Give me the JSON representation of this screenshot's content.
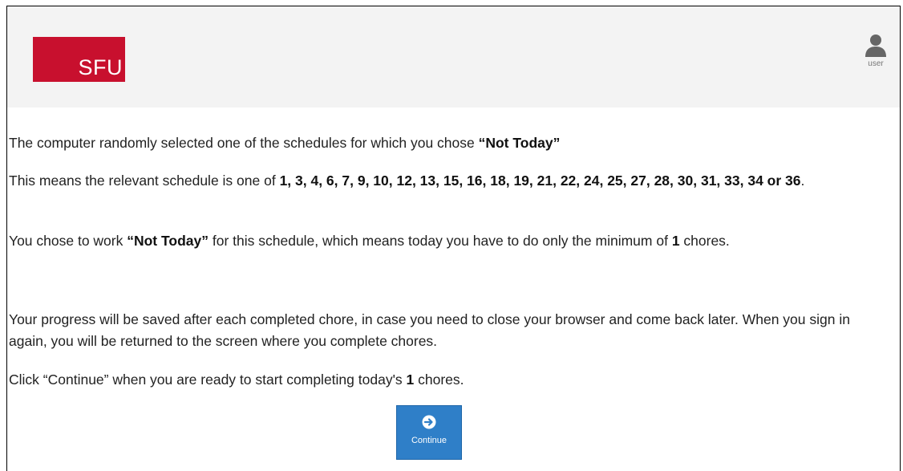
{
  "header": {
    "logo_text": "SFU",
    "user_label": "user"
  },
  "message": {
    "p1_text": "The computer randomly selected one of the schedules for which you chose ",
    "p1_choice": "“Not Today”",
    "p2_text": "This means the relevant schedule is one of ",
    "p2_schedules": "1, 3, 4, 6, 7, 9, 10, 12, 13, 15, 16, 18, 19, 21, 22, 24, 25, 27, 28, 30, 31, 33, 34 or 36",
    "p2_end": ".",
    "p3_text_a": "You chose to work ",
    "p3_choice": "“Not Today”",
    "p3_text_b": " for this schedule, which means today you have to do only the minimum of ",
    "p3_count": "1",
    "p3_text_c": " chores.",
    "p4_text": "Your progress will be saved after each completed chore, in case you need to close your browser and come back later. When you sign in again, you will be returned to the screen where you complete chores.",
    "p5_text_a": "Click “Continue” when you are ready to start completing today's ",
    "p5_count": "1",
    "p5_text_b": " chores."
  },
  "actions": {
    "continue_label": "Continue"
  },
  "colors": {
    "logo_red": "#c8102e",
    "header_bg": "#f3f3f3",
    "button_blue": "#2f7fc8"
  },
  "icons": {
    "user": "user-icon",
    "continue": "arrow-circle-right-icon"
  }
}
